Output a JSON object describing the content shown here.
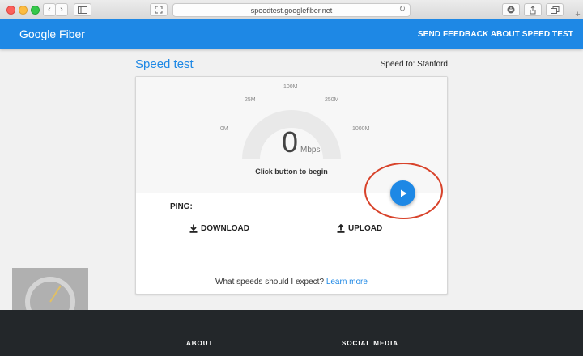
{
  "browser": {
    "url": "speedtest.googlefiber.net"
  },
  "header": {
    "logo": "Google Fiber",
    "feedback": "SEND FEEDBACK ABOUT SPEED TEST"
  },
  "speedtest": {
    "title": "Speed test",
    "speed_to": "Speed to: Stanford",
    "gauge_ticks": [
      "0M",
      "25M",
      "100M",
      "250M",
      "1000M"
    ],
    "value": "0",
    "unit": "Mbps",
    "hint": "Click button to begin",
    "ping_label": "PING:",
    "download_label": "DOWNLOAD",
    "upload_label": "UPLOAD",
    "question": "What speeds should I expect?",
    "learn_more": "Learn more"
  },
  "footer": {
    "about": "ABOUT",
    "social": "SOCIAL MEDIA"
  },
  "colors": {
    "brand": "#1e88e5",
    "annotation": "#d8432b"
  }
}
